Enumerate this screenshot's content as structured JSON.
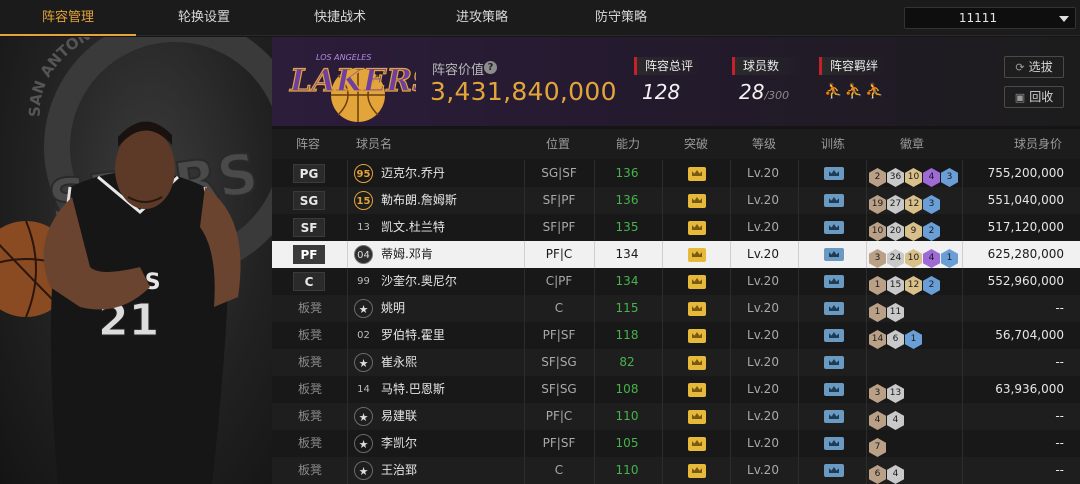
{
  "nav": {
    "tabs": [
      {
        "label": "阵容管理",
        "active": true
      },
      {
        "label": "轮换设置",
        "active": false
      },
      {
        "label": "快捷战术",
        "active": false
      },
      {
        "label": "进攻策略",
        "active": false
      },
      {
        "label": "防守策略",
        "active": false
      }
    ],
    "team_select_value": "11111"
  },
  "team_logo": {
    "text": "LAKERS",
    "subtext": "LOS ANGELES"
  },
  "player_art": {
    "team_logo_text": "SPURS",
    "arc_text": "SAN ANTONIO",
    "jersey_text": "SPURS",
    "jersey_number": "21"
  },
  "summary": {
    "value_label": "阵容价值",
    "value": "3,431,840,000",
    "rating_label": "阵容总评",
    "rating": "128",
    "players_label": "球员数",
    "players": "28",
    "players_max": "/300",
    "bond_label": "阵容羁绊",
    "buttons": {
      "pick": "选拔",
      "recycle": "回收"
    }
  },
  "colors": {
    "accent": "#e3a43a",
    "ability": "#46b34b",
    "selected_row": "#f1f1f1",
    "stat_marker": "#c8202b"
  },
  "table": {
    "headers": [
      "阵容",
      "球员名",
      "位置",
      "能力",
      "突破",
      "等级",
      "训练",
      "徽章",
      "球员身价"
    ],
    "rows": [
      {
        "slot": "PG",
        "starter": true,
        "num": "95",
        "num_style": "gold",
        "name": "迈克尔.乔丹",
        "pos": "SG|SF",
        "ability": "136",
        "level": "Lv.20",
        "badges": [
          [
            "2",
            "#b9a087"
          ],
          [
            "36",
            "#c9c9c9"
          ],
          [
            "10",
            "#d9c08a"
          ],
          [
            "4",
            "#9d6ad6"
          ],
          [
            "3",
            "#6a9ed6"
          ]
        ],
        "worth": "755,200,000"
      },
      {
        "slot": "SG",
        "starter": true,
        "num": "15",
        "num_style": "gold",
        "name": "勒布朗.詹姆斯",
        "pos": "SF|PF",
        "ability": "136",
        "level": "Lv.20",
        "badges": [
          [
            "19",
            "#b9a087"
          ],
          [
            "27",
            "#c9c9c9"
          ],
          [
            "12",
            "#d9c08a"
          ],
          [
            "3",
            "#6a9ed6"
          ]
        ],
        "worth": "551,040,000"
      },
      {
        "slot": "SF",
        "starter": true,
        "num": "13",
        "num_style": "plain",
        "name": "凯文.杜兰特",
        "pos": "SF|PF",
        "ability": "135",
        "level": "Lv.20",
        "badges": [
          [
            "10",
            "#b9a087"
          ],
          [
            "20",
            "#c9c9c9"
          ],
          [
            "9",
            "#d9c08a"
          ],
          [
            "2",
            "#6a9ed6"
          ]
        ],
        "worth": "517,120,000"
      },
      {
        "slot": "PF",
        "starter": true,
        "selected": true,
        "num": "04",
        "num_style": "dark",
        "name": "蒂姆.邓肯",
        "pos": "PF|C",
        "ability": "134",
        "level": "Lv.20",
        "badges": [
          [
            "3",
            "#b9a087"
          ],
          [
            "24",
            "#c9c9c9"
          ],
          [
            "10",
            "#d9c08a"
          ],
          [
            "4",
            "#9d6ad6"
          ],
          [
            "1",
            "#6a9ed6"
          ]
        ],
        "worth": "625,280,000"
      },
      {
        "slot": "C",
        "starter": true,
        "num": "99",
        "num_style": "plain",
        "name": "沙奎尔.奥尼尔",
        "pos": "C|PF",
        "ability": "134",
        "level": "Lv.20",
        "badges": [
          [
            "1",
            "#b9a087"
          ],
          [
            "15",
            "#c9c9c9"
          ],
          [
            "12",
            "#d9c08a"
          ],
          [
            "2",
            "#6a9ed6"
          ]
        ],
        "worth": "552,960,000"
      },
      {
        "slot": "板凳",
        "starter": false,
        "num": "★",
        "num_style": "star",
        "name": "姚明",
        "pos": "C",
        "ability": "115",
        "level": "Lv.20",
        "badges": [
          [
            "1",
            "#b9a087"
          ],
          [
            "11",
            "#c9c9c9"
          ]
        ],
        "worth": "--"
      },
      {
        "slot": "板凳",
        "starter": false,
        "num": "02",
        "num_style": "plain",
        "name": "罗伯特.霍里",
        "pos": "PF|SF",
        "ability": "118",
        "level": "Lv.20",
        "badges": [
          [
            "14",
            "#b9a087"
          ],
          [
            "6",
            "#c9c9c9"
          ],
          [
            "1",
            "#6a9ed6"
          ]
        ],
        "worth": "56,704,000"
      },
      {
        "slot": "板凳",
        "starter": false,
        "num": "★",
        "num_style": "star",
        "name": "崔永熙",
        "pos": "SF|SG",
        "ability": "82",
        "level": "Lv.20",
        "badges": [],
        "worth": "--"
      },
      {
        "slot": "板凳",
        "starter": false,
        "num": "14",
        "num_style": "plain",
        "name": "马特.巴恩斯",
        "pos": "SF|SG",
        "ability": "108",
        "level": "Lv.20",
        "badges": [
          [
            "3",
            "#b9a087"
          ],
          [
            "13",
            "#c9c9c9"
          ]
        ],
        "worth": "63,936,000"
      },
      {
        "slot": "板凳",
        "starter": false,
        "num": "★",
        "num_style": "star",
        "name": "易建联",
        "pos": "PF|C",
        "ability": "110",
        "level": "Lv.20",
        "badges": [
          [
            "4",
            "#b9a087"
          ],
          [
            "4",
            "#c9c9c9"
          ]
        ],
        "worth": "--"
      },
      {
        "slot": "板凳",
        "starter": false,
        "num": "★",
        "num_style": "star",
        "name": "李凯尔",
        "pos": "PF|SF",
        "ability": "105",
        "level": "Lv.20",
        "badges": [
          [
            "7",
            "#b9a087"
          ]
        ],
        "worth": "--"
      },
      {
        "slot": "板凳",
        "starter": false,
        "num": "★",
        "num_style": "star",
        "name": "王治郅",
        "pos": "C",
        "ability": "110",
        "level": "Lv.20",
        "badges": [
          [
            "6",
            "#b9a087"
          ],
          [
            "4",
            "#c9c9c9"
          ]
        ],
        "worth": "--"
      }
    ]
  }
}
